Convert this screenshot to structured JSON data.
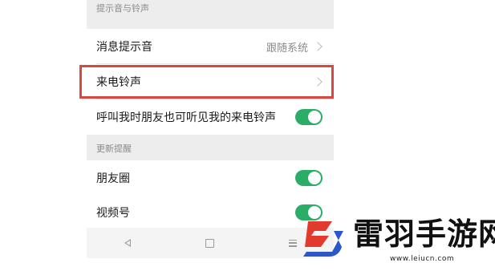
{
  "sections": {
    "sound": {
      "header": "提示音与铃声",
      "message_tone": {
        "label": "消息提示音",
        "value": "跟随系统"
      },
      "ringtone": {
        "label": "来电铃声"
      },
      "friends_hear": {
        "label": "呼叫我时朋友也可听见我的来电铃声",
        "enabled": true
      }
    },
    "updates": {
      "header": "更新提醒",
      "moments": {
        "label": "朋友圈",
        "enabled": true
      },
      "channels": {
        "label": "视频号",
        "enabled": true
      }
    }
  },
  "navbar": {
    "icons": [
      "back-triangle-icon",
      "home-square-icon",
      "menu-lines-icon"
    ]
  },
  "highlight": {
    "color": "#d9473f",
    "target": "来电铃声"
  },
  "watermark": {
    "title": "雷羽手游网",
    "url": "www.leiucn.com",
    "colors": {
      "red": "#e23b2e",
      "blue": "#2c57c9"
    }
  },
  "colors": {
    "toggle_on": "#2aae67",
    "background": "#ededed"
  }
}
